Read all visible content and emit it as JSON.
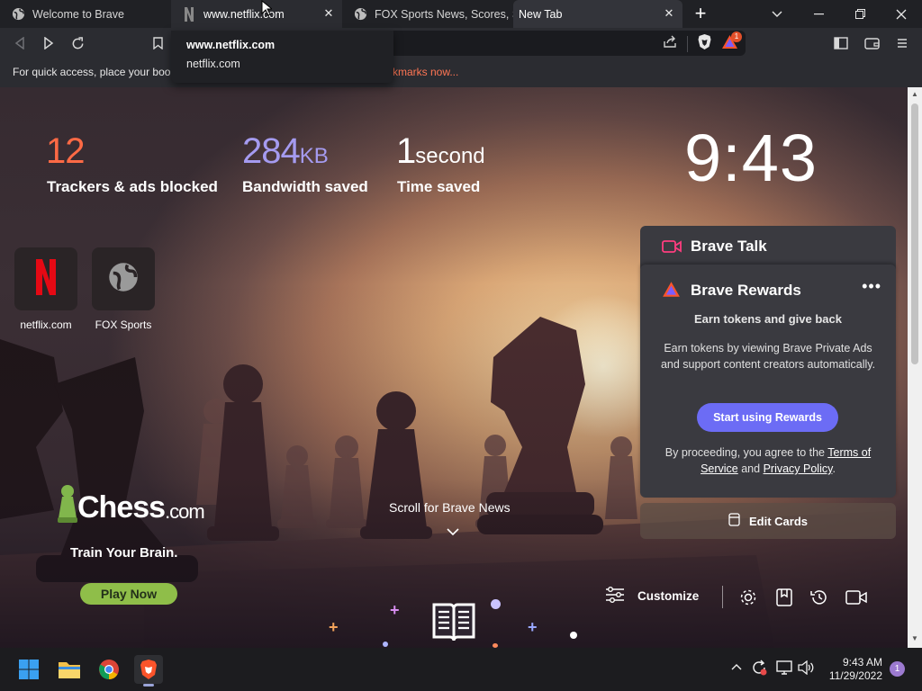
{
  "tabs": [
    {
      "title": "Welcome to Brave",
      "icon": "globe-icon"
    },
    {
      "title": "www.netflix.com",
      "icon": "netflix-icon"
    },
    {
      "title": "FOX Sports News, Scores, Sc",
      "icon": "globe-icon"
    },
    {
      "title": "New Tab",
      "icon": "none"
    }
  ],
  "bookmarks_bar": {
    "prompt": "For quick access, place your book",
    "link": "kmarks now..."
  },
  "hover_card": {
    "title": "www.netflix.com",
    "domain": "netflix.com"
  },
  "toolbar": {
    "rewards_badge": "1"
  },
  "stats": {
    "trackers": {
      "value": "12",
      "label": "Trackers & ads blocked",
      "color": "#ff6a45"
    },
    "bandwidth": {
      "value": "284",
      "unit": "KB",
      "label": "Bandwidth saved",
      "color": "#a59bf0"
    },
    "time": {
      "value": "1",
      "unit": "second",
      "label": "Time saved",
      "color": "#ffffff"
    }
  },
  "clock": "9:43",
  "top_sites": [
    {
      "label": "netflix.com",
      "icon": "netflix-icon"
    },
    {
      "label": "FOX Sports",
      "icon": "globe-icon"
    }
  ],
  "brave_talk": {
    "title": "Brave Talk"
  },
  "brave_rewards": {
    "title": "Brave Rewards",
    "more": "•••",
    "subtitle": "Earn tokens and give back",
    "description": "Earn tokens by viewing Brave Private Ads and support content creators automatically.",
    "cta": "Start using Rewards",
    "legal_prefix": "By proceeding, you agree to the ",
    "terms": "Terms of Service",
    "legal_and": " and ",
    "privacy": "Privacy Policy",
    "legal_suffix": "."
  },
  "edit_cards": "Edit Cards",
  "scroll_news": "Scroll for Brave News",
  "sponsor": {
    "logo_main": "Chess",
    "logo_suffix": ".com",
    "tagline": "Train Your Brain.",
    "cta": "Play Now"
  },
  "customize": "Customize",
  "taskbar": {
    "time": "9:43 AM",
    "date": "11/29/2022",
    "notifications": "1"
  },
  "colors": {
    "accent": "#6c6cf5",
    "brave_orange": "#fb542b",
    "chess_green": "#8fbe49"
  }
}
